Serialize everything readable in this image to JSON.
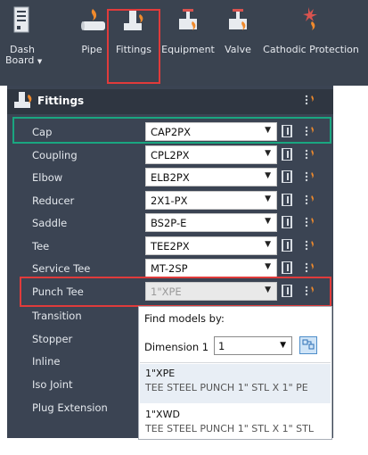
{
  "ribbon": {
    "buttons": [
      {
        "label_line1": "Dash",
        "label_line2": "Board",
        "icon": "dashboard-icon"
      },
      {
        "label_line1": "Pipe",
        "icon": "pipe-icon"
      },
      {
        "label_line1": "Fittings",
        "icon": "fittings-icon"
      },
      {
        "label_line1": "Equipment",
        "icon": "equipment-icon"
      },
      {
        "label_line1": "Valve",
        "icon": "valve-icon"
      },
      {
        "label_line1": "Cathodic Protection",
        "icon": "cathodic-protection-icon"
      }
    ]
  },
  "panel": {
    "title": "Fittings",
    "rows": [
      {
        "label": "Cap",
        "value": "CAP2PX"
      },
      {
        "label": "Coupling",
        "value": "CPL2PX"
      },
      {
        "label": "Elbow",
        "value": "ELB2PX"
      },
      {
        "label": "Reducer",
        "value": "2X1-PX"
      },
      {
        "label": "Saddle",
        "value": "BS2P-E"
      },
      {
        "label": "Tee",
        "value": "TEE2PX"
      },
      {
        "label": "Service Tee",
        "value": "MT-2SP"
      },
      {
        "label": "Punch Tee",
        "value": "1\"XPE"
      },
      {
        "label": "Transition"
      },
      {
        "label": "Stopper"
      },
      {
        "label": "Inline"
      },
      {
        "label": "Iso Joint"
      },
      {
        "label": "Plug Extension"
      }
    ]
  },
  "dropdown": {
    "find_label": "Find models by:",
    "dimension_label": "Dimension 1",
    "dimension_value": "1",
    "items": [
      {
        "name": "1\"XPE",
        "desc": "TEE STEEL PUNCH 1\" STL X 1\" PE"
      },
      {
        "name": "1\"XWD",
        "desc": "TEE STEEL PUNCH 1\" STL X 1\" STL"
      }
    ]
  },
  "colors": {
    "ribbon_bg": "#3a4350",
    "panel_bg": "#3b4453",
    "highlight_red": "#e03b3b",
    "highlight_green": "#1aa680",
    "pipe_orange": "#f08a2c"
  }
}
